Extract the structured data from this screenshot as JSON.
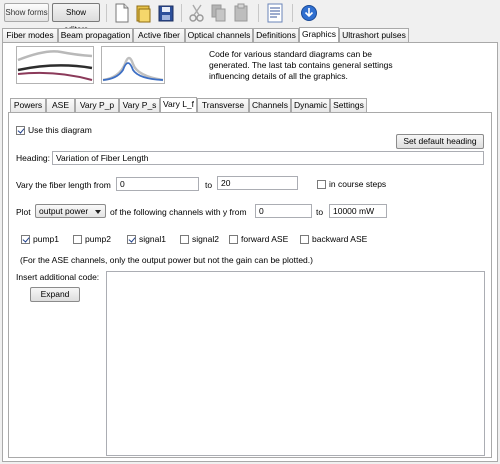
{
  "toolbar": {
    "show_forms": "Show forms",
    "show_editors": "Show editors"
  },
  "main_tabs": [
    {
      "label": "Fiber modes"
    },
    {
      "label": "Beam propagation"
    },
    {
      "label": "Active fiber"
    },
    {
      "label": "Optical channels"
    },
    {
      "label": "Definitions"
    },
    {
      "label": "Graphics"
    },
    {
      "label": "Ultrashort pulses"
    }
  ],
  "description": "Code for various standard diagrams can be generated. The last tab contains general settings influencing details of all the graphics.",
  "sub_tabs": [
    {
      "label": "Powers"
    },
    {
      "label": "ASE"
    },
    {
      "label": "Vary P_p"
    },
    {
      "label": "Vary P_s"
    },
    {
      "label": "Vary L_f"
    },
    {
      "label": "Transverse"
    },
    {
      "label": "Channels"
    },
    {
      "label": "Dynamic"
    },
    {
      "label": "Settings"
    }
  ],
  "form": {
    "use_diagram_label": "Use this diagram",
    "use_diagram_checked": true,
    "set_default_heading": "Set default heading",
    "heading_label": "Heading:",
    "heading_value": "Variation of Fiber Length",
    "vary_label": "Vary the fiber length from",
    "vary_from": "0",
    "vary_to_label": "to",
    "vary_to": "20",
    "course_steps_label": "in course steps",
    "course_steps_checked": false,
    "plot_label": "Plot",
    "plot_select": "output power",
    "channels_label": "of the following channels with y from",
    "y_from": "0",
    "y_to_label": "to",
    "y_to": "10000 mW",
    "channels": [
      {
        "label": "pump1",
        "checked": true
      },
      {
        "label": "pump2",
        "checked": false
      },
      {
        "label": "signal1",
        "checked": true
      },
      {
        "label": "signal2",
        "checked": false
      },
      {
        "label": "forward ASE",
        "checked": false
      },
      {
        "label": "backward ASE",
        "checked": false
      }
    ],
    "ase_note": "(For the ASE channels, only the output power but not the gain can be plotted.)",
    "insert_code_label": "Insert additional code:",
    "expand_button": "Expand",
    "code_value": ""
  },
  "colors": {
    "tab_border": "#a9a9a9",
    "check_color": "#1e3f8a",
    "panel_bg": "#ffffff",
    "window_bg": "#f0f0f0"
  }
}
